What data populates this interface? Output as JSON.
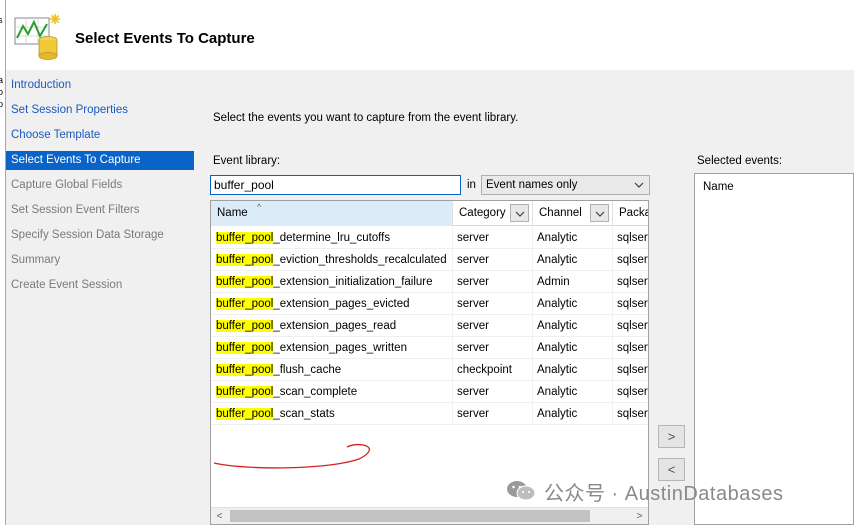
{
  "window": {
    "title": "Select Events To Capture"
  },
  "left_edge_chars": [
    "s",
    "]",
    "]",
    "]",
    "]",
    "a",
    "o",
    "p"
  ],
  "sidebar": {
    "items": [
      {
        "label": "Introduction",
        "state": "link"
      },
      {
        "label": "Set Session Properties",
        "state": "link"
      },
      {
        "label": "Choose Template",
        "state": "link"
      },
      {
        "label": "Select Events To Capture",
        "state": "active"
      },
      {
        "label": "Capture Global Fields",
        "state": "disabled"
      },
      {
        "label": "Set Session Event Filters",
        "state": "disabled"
      },
      {
        "label": "Specify Session Data Storage",
        "state": "disabled"
      },
      {
        "label": "Summary",
        "state": "disabled"
      },
      {
        "label": "Create Event Session",
        "state": "disabled"
      }
    ]
  },
  "main": {
    "instruction": "Select the events you want to capture from the event library.",
    "library_label": "Event library:",
    "search_value": "buffer_pool",
    "in_label": "in",
    "scope_value": "Event names only",
    "selected_label": "Selected events:",
    "selected_header": "Name",
    "add_button": ">",
    "remove_button": "<"
  },
  "grid": {
    "columns": [
      "Name",
      "Category",
      "Channel",
      "Packa"
    ],
    "sort_indicator": "^",
    "highlight": "buffer_pool",
    "rows": [
      {
        "prefix": "buffer_pool",
        "rest": "_determine_lru_cutoffs",
        "category": "server",
        "channel": "Analytic",
        "package": "sqlserv"
      },
      {
        "prefix": "buffer_pool",
        "rest": "_eviction_thresholds_recalculated",
        "category": "server",
        "channel": "Analytic",
        "package": "sqlserv"
      },
      {
        "prefix": "buffer_pool",
        "rest": "_extension_initialization_failure",
        "category": "server",
        "channel": "Admin",
        "package": "sqlserv"
      },
      {
        "prefix": "buffer_pool",
        "rest": "_extension_pages_evicted",
        "category": "server",
        "channel": "Analytic",
        "package": "sqlserv"
      },
      {
        "prefix": "buffer_pool",
        "rest": "_extension_pages_read",
        "category": "server",
        "channel": "Analytic",
        "package": "sqlserv"
      },
      {
        "prefix": "buffer_pool",
        "rest": "_extension_pages_written",
        "category": "server",
        "channel": "Analytic",
        "package": "sqlserv"
      },
      {
        "prefix": "buffer_pool",
        "rest": "_flush_cache",
        "category": "checkpoint",
        "channel": "Analytic",
        "package": "sqlserv"
      },
      {
        "prefix": "buffer_pool",
        "rest": "_scan_complete",
        "category": "server",
        "channel": "Analytic",
        "package": "sqlserv"
      },
      {
        "prefix": "buffer_pool",
        "rest": "_scan_stats",
        "category": "server",
        "channel": "Analytic",
        "package": "sqlserv"
      }
    ],
    "scroll_left": "<",
    "scroll_right": ">"
  },
  "watermark": {
    "text": "公众号 · AustinDatabases"
  },
  "colors": {
    "active_nav": "#0a64c8",
    "link": "#1a58c0",
    "highlight": "#ffff00",
    "annotation": "#d42020"
  }
}
